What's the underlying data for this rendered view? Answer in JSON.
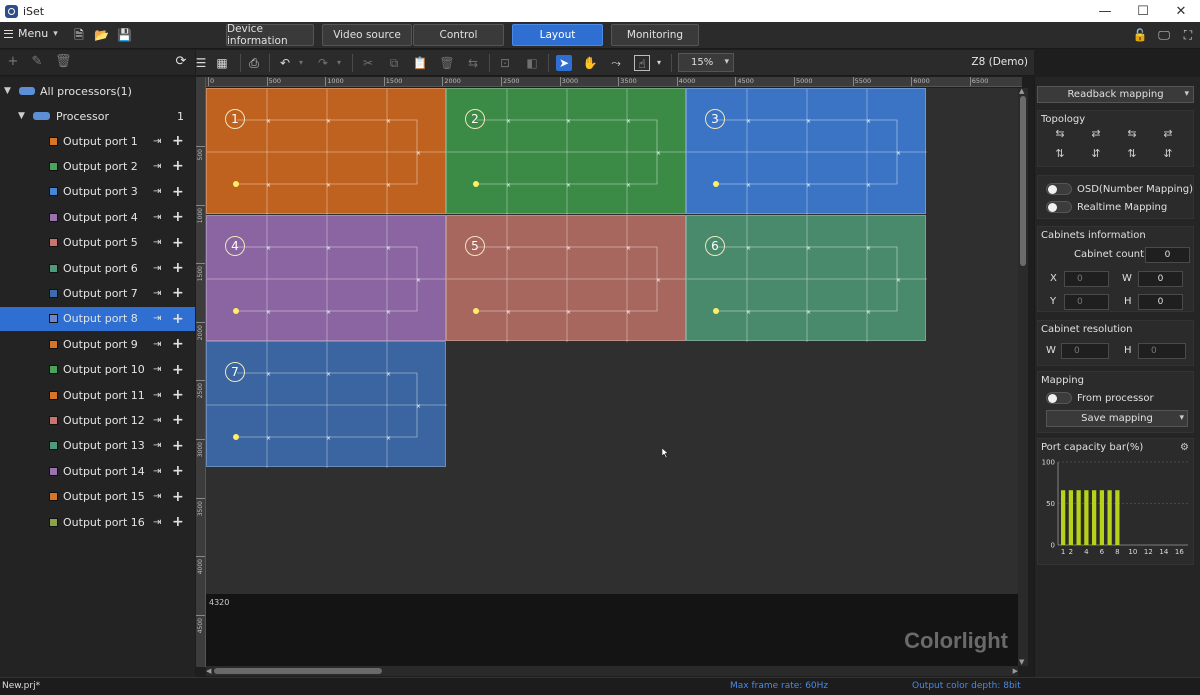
{
  "app": {
    "title": "iSet"
  },
  "menu": {
    "label": "Menu"
  },
  "tabs": [
    {
      "label": "Device information",
      "active": false
    },
    {
      "label": "Video source",
      "active": false
    },
    {
      "label": "Control",
      "active": false
    },
    {
      "label": "Layout",
      "active": true
    },
    {
      "label": "Monitoring",
      "active": false
    }
  ],
  "toolbar": {
    "zoom": "15%",
    "device": "Z8 (Demo)"
  },
  "tree": {
    "root": "All processors(1)",
    "processor": {
      "label": "Processor",
      "count": "1"
    },
    "ports": [
      {
        "label": "Output port 1",
        "color": "#d4752a"
      },
      {
        "label": "Output port 2",
        "color": "#4aa35a"
      },
      {
        "label": "Output port 3",
        "color": "#4a84d4"
      },
      {
        "label": "Output port 4",
        "color": "#9a72b0"
      },
      {
        "label": "Output port 5",
        "color": "#c7756e"
      },
      {
        "label": "Output port 6",
        "color": "#4f9a78"
      },
      {
        "label": "Output port 7",
        "color": "#3e6ea9"
      },
      {
        "label": "Output port 8",
        "color": "#6a86cc"
      },
      {
        "label": "Output port 9",
        "color": "#d4752a"
      },
      {
        "label": "Output port 10",
        "color": "#4aa35a"
      },
      {
        "label": "Output port 11",
        "color": "#d4752a"
      },
      {
        "label": "Output port 12",
        "color": "#c7756e"
      },
      {
        "label": "Output port 13",
        "color": "#4f9a78"
      },
      {
        "label": "Output port 14",
        "color": "#9a72b0"
      },
      {
        "label": "Output port 15",
        "color": "#d4752a"
      },
      {
        "label": "Output port 16",
        "color": "#8aa34a"
      }
    ],
    "selected_index": 7
  },
  "ruler": {
    "h_ticks": [
      "0",
      "500",
      "1000",
      "1500",
      "2000",
      "2500",
      "3000",
      "3500",
      "4000",
      "4500",
      "5000",
      "5500",
      "6000",
      "6500"
    ],
    "v_ticks": [
      "500",
      "1000",
      "1500",
      "2000",
      "2500",
      "3000",
      "3500",
      "4000",
      "4500"
    ]
  },
  "canvas": {
    "height_label": "4320",
    "watermark": "Colorlight",
    "ports": [
      {
        "num": "1",
        "color": "#c0621f"
      },
      {
        "num": "2",
        "color": "#3b8a46"
      },
      {
        "num": "3",
        "color": "#3b74c4"
      },
      {
        "num": "4",
        "color": "#8a65a2"
      },
      {
        "num": "5",
        "color": "#a7675f"
      },
      {
        "num": "6",
        "color": "#4a8a6c"
      },
      {
        "num": "7",
        "color": "#3a65a0"
      }
    ]
  },
  "right_panel": {
    "readback": "Readback mapping",
    "topology_title": "Topology",
    "osd_label": "OSD(Number Mapping)",
    "realtime_label": "Realtime Mapping",
    "cabinets_title": "Cabinets information",
    "cabinet_count_label": "Cabinet count",
    "cabinet_count": "0",
    "x_label": "X",
    "x_placeholder": "0",
    "w_label": "W",
    "w_value": "0",
    "y_label": "Y",
    "y_placeholder": "0",
    "h_label": "H",
    "h_value": "0",
    "resolution_title": "Cabinet resolution",
    "res_w_label": "W",
    "res_w_placeholder": "0",
    "res_h_label": "H",
    "res_h_placeholder": "0",
    "mapping_title": "Mapping",
    "from_processor_label": "From processor",
    "save_mapping": "Save mapping",
    "capacity_title": "Port capacity bar(%)"
  },
  "chart_data": {
    "type": "bar",
    "title": "Port capacity bar(%)",
    "categories": [
      "1",
      "2",
      "3",
      "4",
      "5",
      "6",
      "7",
      "8",
      "9",
      "10",
      "11",
      "12",
      "13",
      "14",
      "15",
      "16"
    ],
    "x_tick_labels": [
      "1",
      "2",
      "4",
      "6",
      "8",
      "10",
      "12",
      "14",
      "16"
    ],
    "values": [
      66,
      66,
      66,
      66,
      66,
      66,
      66,
      66,
      0,
      0,
      0,
      0,
      0,
      0,
      0,
      0
    ],
    "ylim": [
      0,
      100
    ],
    "y_tick_labels": [
      "0",
      "50",
      "100"
    ],
    "grid": true,
    "bar_color": "#b7d21a"
  },
  "status": {
    "file": "New.prj*",
    "frame_rate": "Max frame rate: 60Hz",
    "color_depth": "Output color depth: 8bit"
  }
}
